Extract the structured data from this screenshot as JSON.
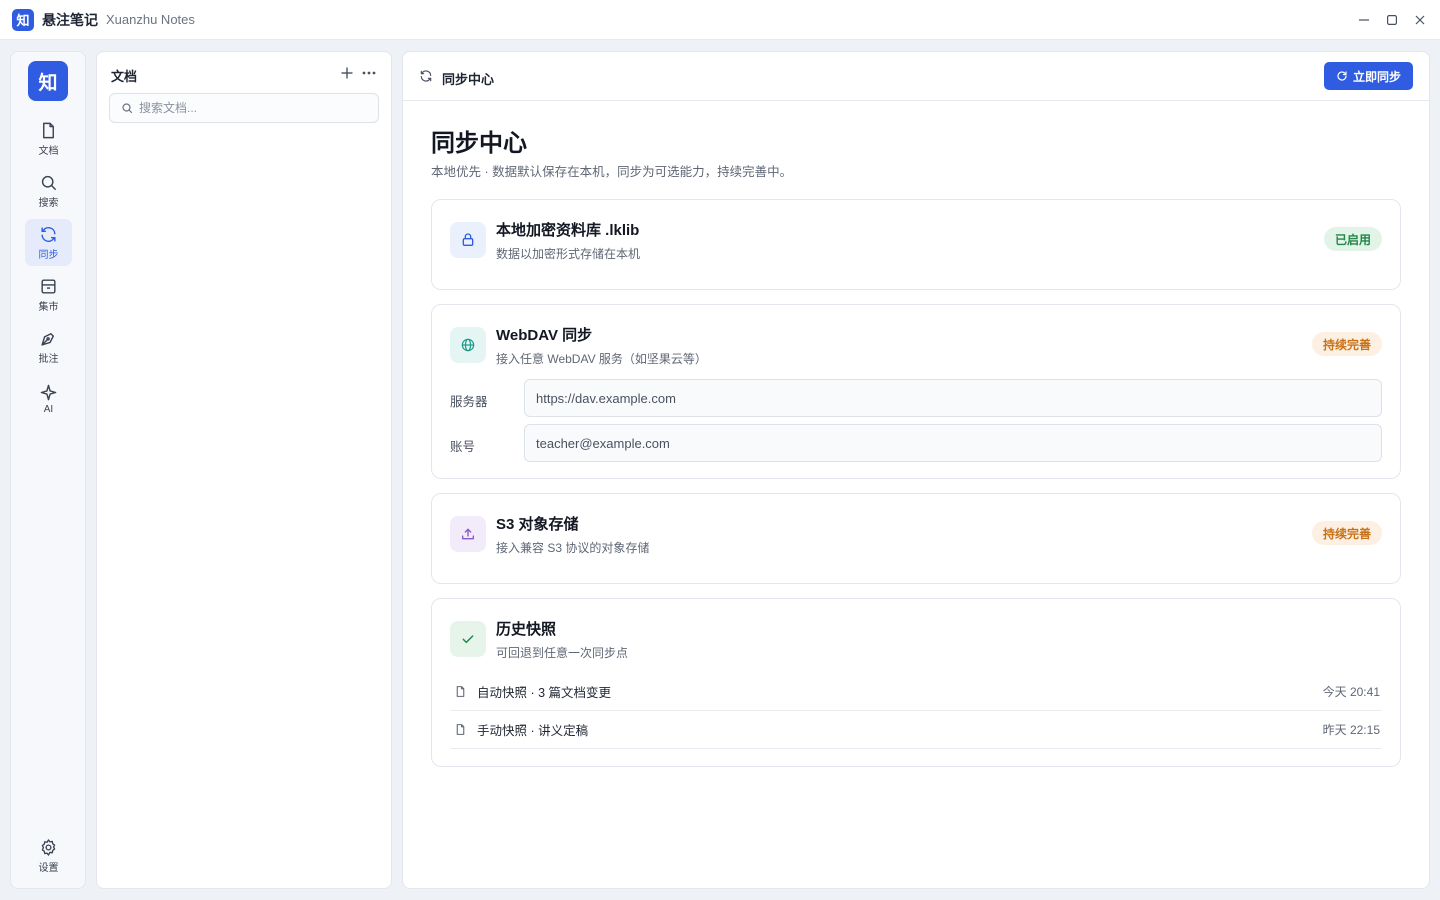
{
  "titlebar": {
    "logo": "知",
    "app_name": "悬注笔记",
    "app_subtitle": "Xuanzhu Notes",
    "controls": [
      "minimize-icon",
      "maximize-icon",
      "close-icon"
    ]
  },
  "rail": {
    "logo": "知",
    "items": [
      {
        "label": "文档",
        "icon": "file-icon",
        "active": false
      },
      {
        "label": "搜索",
        "icon": "search-icon",
        "active": false
      },
      {
        "label": "同步",
        "icon": "sync-icon",
        "active": true
      },
      {
        "label": "集市",
        "icon": "market-icon",
        "active": false
      },
      {
        "label": "批注",
        "icon": "pen-icon",
        "active": false
      },
      {
        "label": "AI",
        "icon": "sparkle-icon",
        "active": false
      }
    ],
    "settings": {
      "label": "设置",
      "icon": "gear-icon"
    }
  },
  "docs": {
    "title": "文档",
    "search_placeholder": "搜索文档..."
  },
  "main": {
    "header_title": "同步中心",
    "sync_button": "立即同步",
    "page_title": "同步中心",
    "page_subtitle": "本地优先 · 数据默认保存在本机，同步为可选能力，持续完善中。",
    "cards": {
      "local": {
        "title": "本地加密资料库 .lklib",
        "desc": "数据以加密形式存储在本机",
        "badge": "已启用",
        "icon": "lock-icon"
      },
      "webdav": {
        "title": "WebDAV 同步",
        "desc": "接入任意 WebDAV 服务（如坚果云等）",
        "badge": "持续完善",
        "icon": "globe-icon",
        "server_label": "服务器",
        "server_value": "https://dav.example.com",
        "account_label": "账号",
        "account_value": "teacher@example.com"
      },
      "s3": {
        "title": "S3 对象存储",
        "desc": "接入兼容 S3 协议的对象存储",
        "badge": "持续完善",
        "icon": "upload-icon"
      },
      "history": {
        "title": "历史快照",
        "desc": "可回退到任意一次同步点",
        "icon": "check-icon",
        "snapshots": [
          {
            "text": "自动快照 · 3 篇文档变更",
            "time": "今天 20:41"
          },
          {
            "text": "手动快照 · 讲义定稿",
            "time": "昨天 22:15"
          }
        ]
      }
    }
  },
  "colors": {
    "accent": "#2f5ce0",
    "enabled": "#24864a",
    "in_progress": "#c8731c"
  }
}
